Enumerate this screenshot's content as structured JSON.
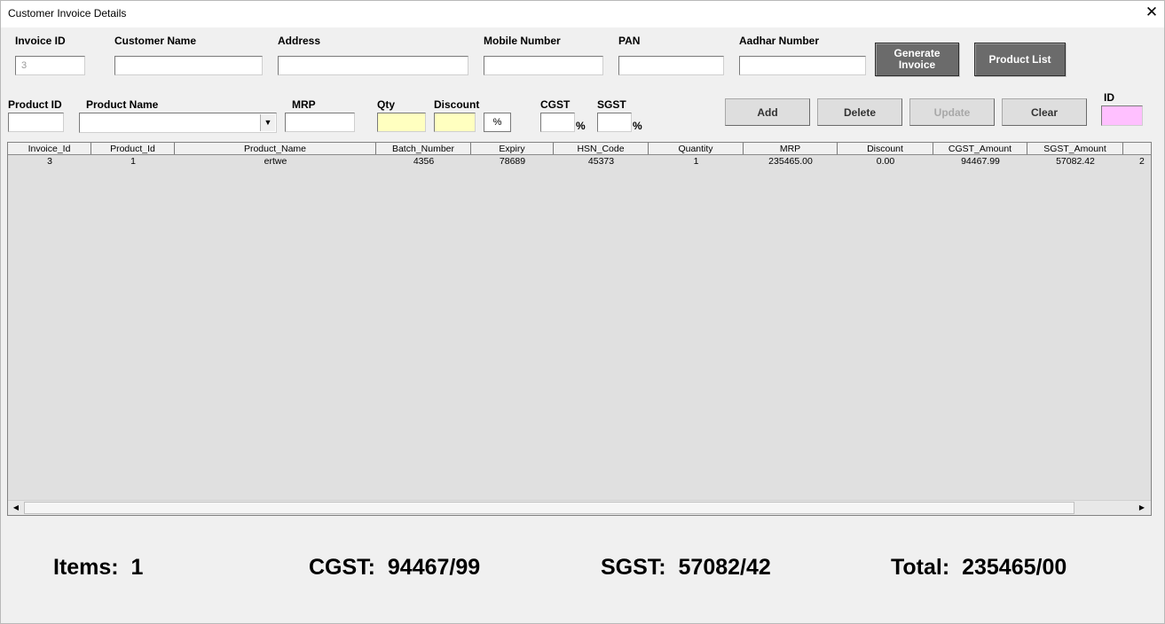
{
  "window": {
    "title": "Customer Invoice Details",
    "close_glyph": "✕"
  },
  "customer": {
    "invoice_id_label": "Invoice ID",
    "invoice_id_value": "3",
    "customer_name_label": "Customer Name",
    "customer_name_value": "",
    "address_label": "Address",
    "address_value": "",
    "mobile_label": "Mobile Number",
    "mobile_value": "",
    "pan_label": "PAN",
    "pan_value": "",
    "aadhar_label": "Aadhar Number",
    "aadhar_value": ""
  },
  "buttons": {
    "generate_invoice_line1": "Generate",
    "generate_invoice_line2": "Invoice",
    "product_list": "Product List",
    "add": "Add",
    "delete": "Delete",
    "update": "Update",
    "clear": "Clear"
  },
  "product": {
    "product_id_label": "Product ID",
    "product_id_value": "",
    "product_name_label": "Product Name",
    "product_name_value": "",
    "mrp_label": "MRP",
    "mrp_value": "",
    "qty_label": "Qty",
    "qty_value": "",
    "discount_label": "Discount",
    "discount_value": "",
    "discount_unit": "%",
    "cgst_label": "CGST",
    "cgst_value": "",
    "cgst_unit": "%",
    "sgst_label": "SGST",
    "sgst_value": "",
    "sgst_unit": "%",
    "id_label": "ID",
    "id_value": ""
  },
  "grid": {
    "columns": [
      "Invoice_Id",
      "Product_Id",
      "Product_Name",
      "Batch_Number",
      "Expiry",
      "HSN_Code",
      "Quantity",
      "MRP",
      "Discount",
      "CGST_Amount",
      "SGST_Amount",
      ""
    ],
    "rows": [
      [
        "3",
        "1",
        "ertwe",
        "4356",
        "78689",
        "45373",
        "1",
        "235465.00",
        "0.00",
        "94467.99",
        "57082.42",
        "2"
      ]
    ]
  },
  "summary": {
    "items_label": "Items:",
    "items_value": "1",
    "cgst_label": "CGST:",
    "cgst_value": "94467/99",
    "sgst_label": "SGST:",
    "sgst_value": "57082/42",
    "total_label": "Total:",
    "total_value": "235465/00"
  },
  "icons": {
    "dropdown": "chevron-down-icon",
    "scroll_left": "arrow-left-icon",
    "scroll_right": "arrow-right-icon"
  },
  "colors": {
    "dark_button": "#6b6b6b",
    "qty_bg": "#ffffc0",
    "id_bg": "#ffc0ff",
    "grid_bg": "#e0e0e0"
  }
}
